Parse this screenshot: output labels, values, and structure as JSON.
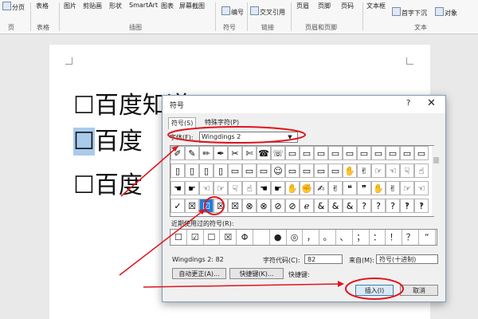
{
  "ribbon": {
    "items": [
      "分页",
      "表格",
      "图片",
      "剪贴画",
      "形状",
      "SmartArt",
      "图表",
      "屏幕截图",
      "编号",
      "交叉引用",
      "页眉",
      "页脚",
      "页码",
      "文本框",
      "首字下沉",
      "对象"
    ],
    "groups": [
      "页",
      "表格",
      "插图",
      "符号",
      "链接",
      "页眉和页脚",
      "文本"
    ]
  },
  "document": {
    "lines": [
      {
        "box": "☐",
        "text": "百度知道"
      },
      {
        "box": "☐",
        "text": "百度"
      },
      {
        "box": "☐",
        "text": "百度"
      }
    ]
  },
  "dialog": {
    "title": "符号",
    "help": "?",
    "close": "✕",
    "tabs": [
      "符号(S)",
      "特殊字符(P)"
    ],
    "font_label": "字体(F):",
    "font_value": "Wingdings 2",
    "symbol_rows": [
      [
        "✐",
        "✎",
        "✏",
        "✒",
        "✂",
        "✄",
        "☎",
        "☏",
        "▭",
        "▭",
        "▭",
        "▭",
        "▭",
        "▭",
        "▭",
        "▭",
        "▭",
        "▭"
      ],
      [
        "▯",
        "▯",
        "▯",
        "▯",
        "▭",
        "▭",
        "▭",
        "☺",
        "▭",
        "▭",
        "▭",
        "▭",
        "✋",
        "✌",
        "☞",
        "☜",
        "☟",
        "☝"
      ],
      [
        "☚",
        "☛",
        "☜",
        "☞",
        "☟",
        "☝",
        "☚",
        "☛",
        "✋",
        "✊",
        "✍",
        "✌",
        "❝",
        "❞",
        "✋",
        "✌",
        "☞",
        "☜"
      ],
      [
        "✓",
        "☒",
        "☑",
        "☒",
        "☒",
        "⊗",
        "⊗",
        "⊘",
        "⊘",
        "ℯ",
        "&",
        "&",
        "&",
        "?",
        "?",
        "?",
        "‽",
        "‽"
      ]
    ],
    "selected_symbol": "☑",
    "recent_label": "近期使用过的符号(R):",
    "recent_symbols": [
      "☐",
      "☑",
      "☐",
      "☒",
      "Φ",
      "",
      "●",
      "◎",
      "，",
      "。",
      "、",
      "；",
      "：",
      "！",
      "？",
      "“"
    ],
    "font_code_info": "Wingdings 2: 82",
    "char_code_label": "字符代码(C):",
    "char_code_value": "82",
    "from_label": "来自(M):",
    "from_value": "符号(十进制)",
    "autocorrect_button": "自动更正(A)...",
    "shortcut_key_button": "快捷键(K)...",
    "shortcut_label": "快捷键:",
    "insert_button": "插入(I)",
    "cancel_button": "取消"
  },
  "colors": {
    "annotation": "#e0141e",
    "selection": "#1c7ce0",
    "highlight": "#a9cbec"
  }
}
